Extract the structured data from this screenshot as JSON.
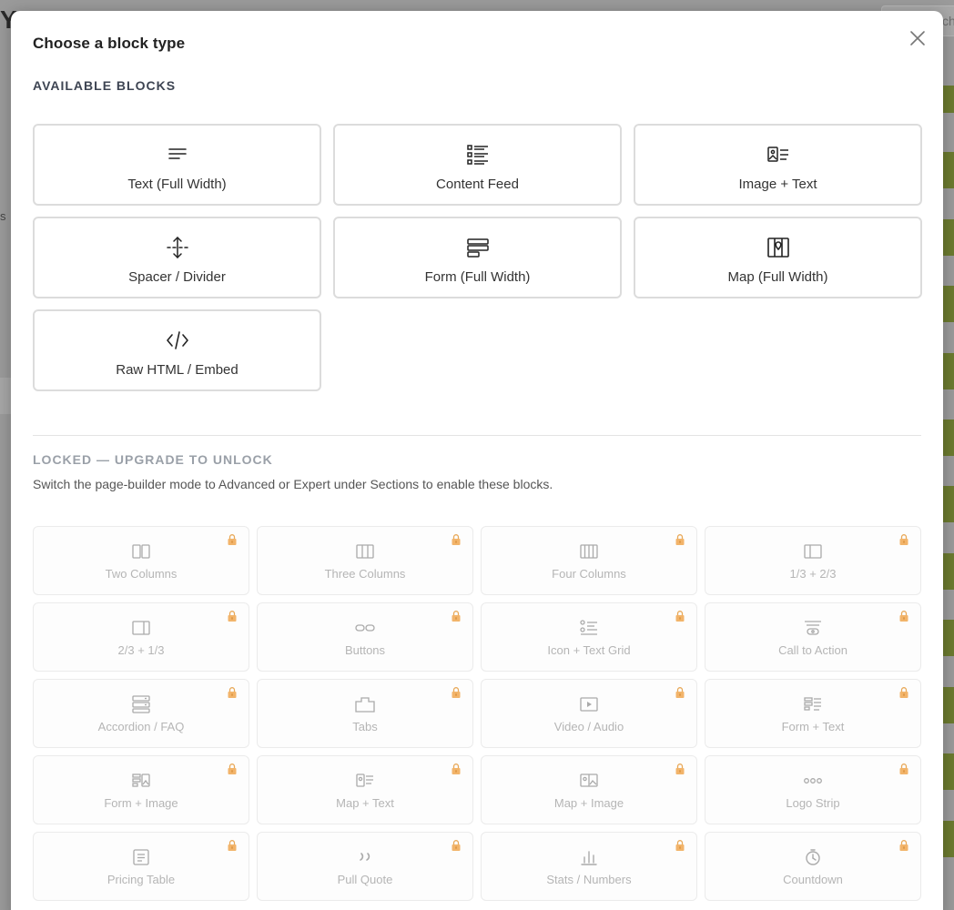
{
  "background": {
    "letter": "Y",
    "side_text": "s",
    "search_text": "ch"
  },
  "modal": {
    "title": "Choose a block type",
    "available_heading": "AVAILABLE BLOCKS",
    "available_blocks": [
      {
        "label": "Text (Full Width)",
        "icon": "text-lines-icon"
      },
      {
        "label": "Content Feed",
        "icon": "list-feed-icon"
      },
      {
        "label": "Image + Text",
        "icon": "image-text-icon"
      },
      {
        "label": "Spacer / Divider",
        "icon": "spacer-icon"
      },
      {
        "label": "Form (Full Width)",
        "icon": "form-icon"
      },
      {
        "label": "Map (Full Width)",
        "icon": "map-icon"
      },
      {
        "label": "Raw HTML / Embed",
        "icon": "code-icon"
      }
    ],
    "locked_heading": "LOCKED — UPGRADE TO UNLOCK",
    "locked_description": "Switch the page-builder mode to Advanced or Expert under Sections to enable these blocks.",
    "locked_blocks": [
      {
        "label": "Two Columns",
        "icon": "two-columns-icon"
      },
      {
        "label": "Three Columns",
        "icon": "three-columns-icon"
      },
      {
        "label": "Four Columns",
        "icon": "four-columns-icon"
      },
      {
        "label": "1/3 + 2/3",
        "icon": "one-third-two-thirds-icon"
      },
      {
        "label": "2/3 + 1/3",
        "icon": "two-thirds-one-third-icon"
      },
      {
        "label": "Buttons",
        "icon": "buttons-icon"
      },
      {
        "label": "Icon + Text Grid",
        "icon": "icon-text-grid-icon"
      },
      {
        "label": "Call to Action",
        "icon": "call-to-action-icon"
      },
      {
        "label": "Accordion / FAQ",
        "icon": "accordion-icon"
      },
      {
        "label": "Tabs",
        "icon": "tabs-icon"
      },
      {
        "label": "Video / Audio",
        "icon": "video-icon"
      },
      {
        "label": "Form + Text",
        "icon": "form-text-icon"
      },
      {
        "label": "Form + Image",
        "icon": "form-image-icon"
      },
      {
        "label": "Map + Text",
        "icon": "map-text-icon"
      },
      {
        "label": "Map + Image",
        "icon": "map-image-icon"
      },
      {
        "label": "Logo Strip",
        "icon": "logo-strip-icon"
      },
      {
        "label": "Pricing Table",
        "icon": "pricing-table-icon"
      },
      {
        "label": "Pull Quote",
        "icon": "pull-quote-icon"
      },
      {
        "label": "Stats / Numbers",
        "icon": "stats-icon"
      },
      {
        "label": "Countdown",
        "icon": "countdown-icon"
      }
    ]
  },
  "colors": {
    "overlay": "#9a9a9a",
    "accent_green": "#6b7a2f",
    "lock": "#f0a040"
  }
}
